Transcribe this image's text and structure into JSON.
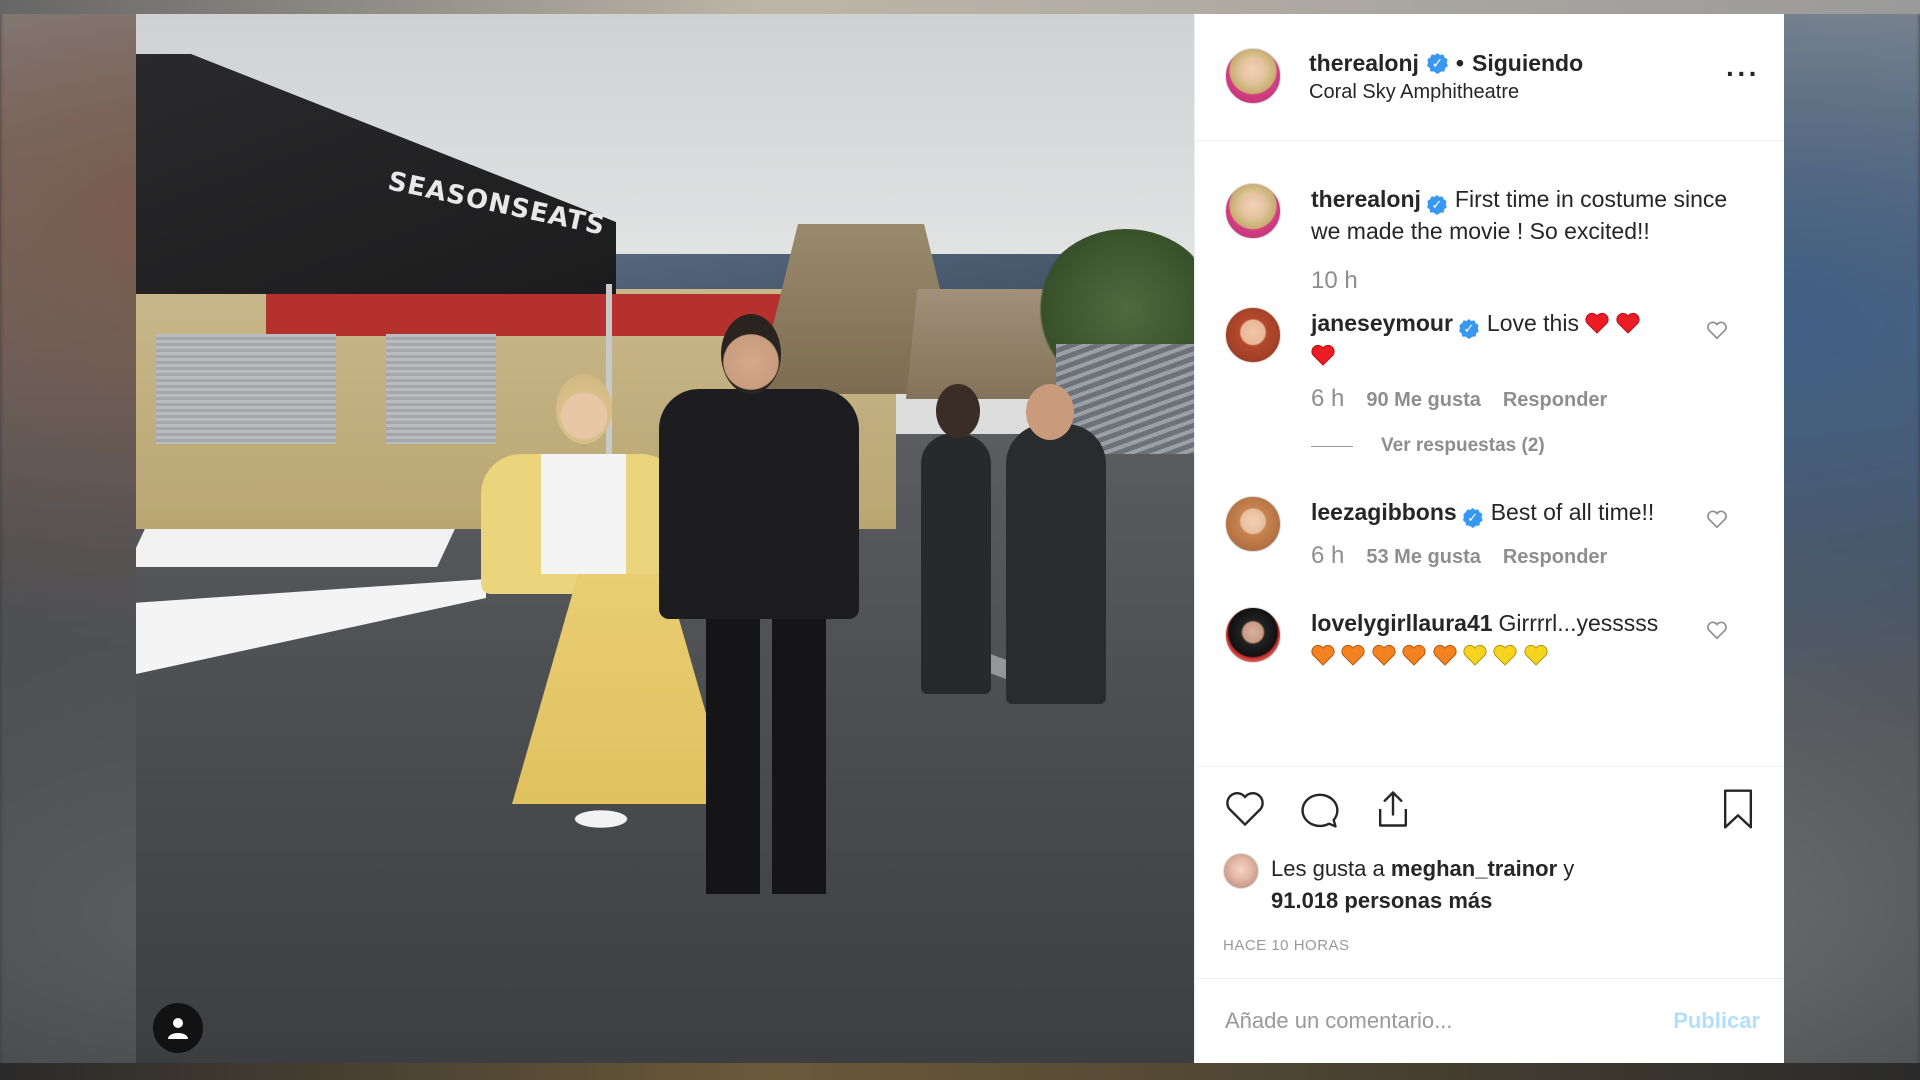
{
  "post": {
    "username": "therealonj",
    "follow_status": "Siguiendo",
    "separator": "•",
    "location": "Coral Sky Amphitheatre",
    "more_icon": "more-horizontal-icon",
    "photo_signs": {
      "tent": "SEASONSEATS"
    }
  },
  "caption": {
    "username": "therealonj",
    "text": "First time in costume since we made the movie ! So excited!!",
    "time": "10 h"
  },
  "comments": [
    {
      "username": "janeseymour",
      "verified": true,
      "text": "Love this",
      "time": "6 h",
      "likes": "90 Me gusta",
      "reply": "Responder",
      "view_replies": "Ver respuestas (2)"
    },
    {
      "username": "leezagibbons",
      "verified": true,
      "text": "Best of all time!!",
      "time": "6 h",
      "likes": "53 Me gusta",
      "reply": "Responder"
    },
    {
      "username": "lovelygirllaura41",
      "verified": false,
      "text": "Girrrrl...yesssss"
    }
  ],
  "likes": {
    "prefix": "Les gusta a",
    "user": "meghan_trainor",
    "conjunction": "y",
    "count_text": "91.018 personas más"
  },
  "timestamp": "HACE 10 HORAS",
  "comment_box": {
    "placeholder": "Añade un comentario...",
    "publish_label": "Publicar"
  },
  "colors": {
    "verified": "#3897f0",
    "heart_red": "#ed1c24",
    "heart_orange": "#f58220",
    "heart_yellow": "#f6d31f",
    "publish_disabled": "#b2dffc",
    "meta_gray": "#8e8e8e"
  }
}
